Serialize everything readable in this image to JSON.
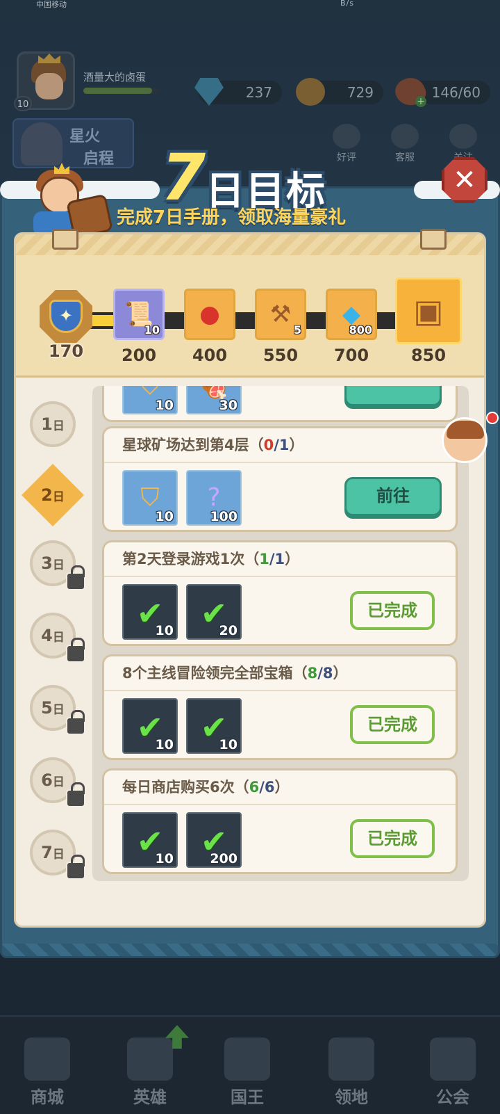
{
  "status_bar": {
    "carrier": "中国移动",
    "speed_unit": "B/s"
  },
  "player": {
    "name": "酒量大的卤蛋",
    "level": "10",
    "exp_fraction": 0.9
  },
  "resources": {
    "gems": "237",
    "coins": "729",
    "stamina": "146/60"
  },
  "side_event": {
    "line1": "星火",
    "line2": "启程"
  },
  "top_links": [
    {
      "label": "好评",
      "icon": "thumbs-up-icon"
    },
    {
      "label": "客服",
      "icon": "headset-icon"
    },
    {
      "label": "关注",
      "icon": "star-icon"
    }
  ],
  "modal": {
    "title_num": "7",
    "title_text": "日目标",
    "subtitle": "完成7日手册，领取海量豪礼",
    "close_symbol": "✕"
  },
  "progress": {
    "current": "170",
    "fill_fraction": 0.0,
    "milestones": [
      {
        "value": "200",
        "icon": "scroll-icon",
        "count": "10",
        "color": "#8d89d9"
      },
      {
        "value": "400",
        "icon": "red-orb-icon",
        "count": "",
        "color": "#f4a93d"
      },
      {
        "value": "550",
        "icon": "hammer-icon",
        "count": "5",
        "color": "#f4a93d"
      },
      {
        "value": "700",
        "icon": "diamond-icon",
        "count": "800",
        "color": "#f4b04a"
      },
      {
        "value": "850",
        "icon": "treasure-chest-icon",
        "count": "",
        "color": "#f4a93d"
      }
    ]
  },
  "days": [
    {
      "num": "1",
      "suffix": "日",
      "locked": false,
      "active": false
    },
    {
      "num": "2",
      "suffix": "日",
      "locked": false,
      "active": true
    },
    {
      "num": "3",
      "suffix": "日",
      "locked": true,
      "active": false
    },
    {
      "num": "4",
      "suffix": "日",
      "locked": true,
      "active": false
    },
    {
      "num": "5",
      "suffix": "日",
      "locked": true,
      "active": false
    },
    {
      "num": "6",
      "suffix": "日",
      "locked": true,
      "active": false
    },
    {
      "num": "7",
      "suffix": "日",
      "locked": true,
      "active": false
    }
  ],
  "tasks": [
    {
      "title": "",
      "progress_done": "",
      "progress_total": "",
      "rewards": [
        {
          "icon": "shield-badge-icon",
          "count": "10"
        },
        {
          "icon": "meat-icon",
          "count": "30"
        }
      ],
      "button": ""
    },
    {
      "title": "星球矿场达到第4层",
      "progress_done": "0",
      "progress_total": "1",
      "rewards": [
        {
          "icon": "shield-badge-icon",
          "count": "10"
        },
        {
          "icon": "mystery-orb-icon",
          "count": "100"
        }
      ],
      "button": "前往"
    },
    {
      "title": "第2天登录游戏1次",
      "progress_done": "1",
      "progress_total": "1",
      "rewards": [
        {
          "icon": "shield-badge-icon",
          "count": "10"
        },
        {
          "icon": "scroll-icon",
          "count": "20"
        }
      ],
      "button": "已完成"
    },
    {
      "title": "8个主线冒险领完全部宝箱",
      "progress_done": "8",
      "progress_total": "8",
      "rewards": [
        {
          "icon": "shield-badge-icon",
          "count": "10"
        },
        {
          "icon": "scroll-icon",
          "count": "10"
        }
      ],
      "button": "已完成"
    },
    {
      "title": "每日商店购买6次",
      "progress_done": "6",
      "progress_total": "6",
      "rewards": [
        {
          "icon": "shield-badge-icon",
          "count": "10"
        },
        {
          "icon": "crystal-icon",
          "count": "200"
        }
      ],
      "button": "已完成"
    }
  ],
  "paren_open": "（",
  "paren_close": "）",
  "slash": "/",
  "bottom_nav": [
    {
      "label": "商城",
      "icon": "shop-icon"
    },
    {
      "label": "英雄",
      "icon": "helmet-icon"
    },
    {
      "label": "国王",
      "icon": "crown-icon"
    },
    {
      "label": "领地",
      "icon": "castle-icon"
    },
    {
      "label": "公会",
      "icon": "lock-icon"
    }
  ]
}
